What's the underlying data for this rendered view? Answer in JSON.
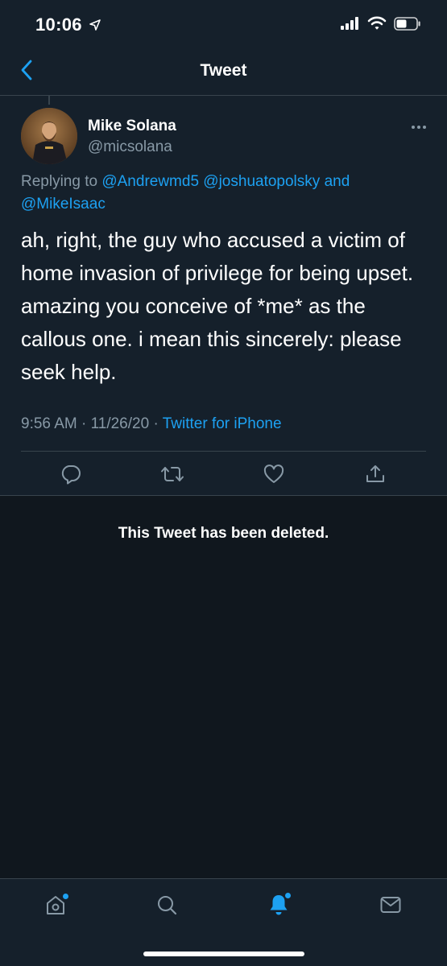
{
  "status_bar": {
    "time": "10:06",
    "icons": [
      "location-arrow-icon",
      "cellular-signal-icon",
      "wifi-icon",
      "battery-icon"
    ]
  },
  "nav": {
    "title": "Tweet",
    "back_icon": "chevron-left-icon"
  },
  "tweet": {
    "author_name": "Mike Solana",
    "author_handle": "@micsolana",
    "replying_prefix": "Replying to",
    "mentions": [
      "@Andrewmd5",
      "@joshuatopolsky",
      "@MikeIsaac"
    ],
    "mention_joiner": "and",
    "text": "ah, right, the guy who accused a victim of home invasion of privilege for being upset. amazing you conceive of *me* as the callous one. i mean this sincerely: please seek help.",
    "time": "9:56 AM",
    "separator": "·",
    "date": "11/26/20",
    "source": "Twitter for iPhone",
    "actions": [
      "reply-icon",
      "retweet-icon",
      "like-icon",
      "share-icon"
    ]
  },
  "deleted_notice": "This Tweet has been deleted.",
  "tab_bar": {
    "tabs": [
      "home-icon",
      "search-icon",
      "notifications-icon",
      "messages-icon"
    ],
    "active_tab": "notifications-icon",
    "unread_dots": [
      "home-icon",
      "notifications-icon"
    ]
  },
  "colors": {
    "background": "#15202b",
    "deleted_background": "#10171e",
    "accent": "#1da1f2",
    "secondary_text": "#8899a6",
    "divider": "#38444d"
  }
}
